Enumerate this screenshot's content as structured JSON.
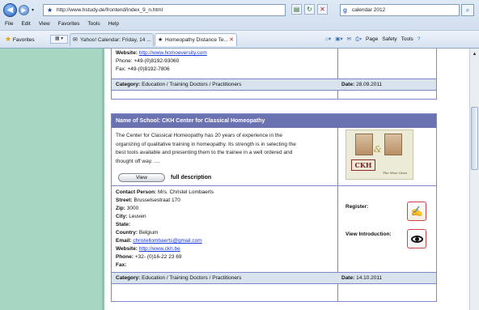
{
  "browser": {
    "address_url": "http://www.hstudy.de/frontend/index_9_n.html",
    "search_text": "calendar 2012",
    "menu": [
      "File",
      "Edit",
      "View",
      "Favorites",
      "Tools",
      "Help"
    ],
    "favorites_label": "Favorites",
    "tabs": [
      {
        "label": "Yahoo! Calendar: Friday, 14 ...",
        "active": false
      },
      {
        "label": "Homeopathy Distance Te...",
        "active": true
      }
    ],
    "commands": [
      "Page",
      "Safety",
      "Tools"
    ]
  },
  "prev_listing": {
    "website_label": "Website:",
    "website_url": "http://www.homoeversity.com",
    "phone": "Phone: +49-(0)8192-93060",
    "fax": "Fax: +49-(0)8192-7806",
    "category_label": "Category:",
    "category_value": "Education / Training Doctors / Practitioners",
    "date_label": "Date:",
    "date_value": "28.09.2011"
  },
  "listing": {
    "header": "Name of School: CKH Center for Classical Homeopathy",
    "description_lines": [
      "The Center for Classical Homeopathy has 20 years of experience in the",
      "organizing of qualitative training in homeopathy. Its strength is in selecting the",
      "best tools available and presenting them to the trainee in a well ordered and",
      "thought off way. ...."
    ],
    "view_button": "View",
    "full_description": "full description",
    "logo": {
      "letters": "CKH",
      "amp": "&",
      "caption": "The Wise Ones"
    },
    "contact_label": "Contact Person:",
    "contact_value": "Mrs. Christel Lombaerts",
    "street_label": "Street:",
    "street_value": "Brusselsestraat 170",
    "zip_label": "Zip:",
    "zip_value": "3000",
    "city_label": "City:",
    "city_value": "Leuven",
    "state_label": "State:",
    "state_value": "",
    "country_label": "Country:",
    "country_value": "Belgium",
    "email_label": "Email:",
    "email_value": "christellombaerts@gmail.com",
    "website_label": "Website:",
    "website_value": "http://www.ckh.be",
    "phone_label": "Phone:",
    "phone_value": "+32- (0)16-22 23 69",
    "fax_label": "Fax:",
    "fax_value": "",
    "register_label": "Register:",
    "intro_label": "View Introduction:",
    "category_label": "Category:",
    "category_value": "Education / Training Doctors / Practitioners",
    "date_label": "Date:",
    "date_value": "14.10.2011"
  },
  "colors": {
    "left_panel": "#a7d6c2",
    "header_bar": "#6b72b2",
    "footer_bar": "#d8e3ee",
    "link": "#1a35d8"
  }
}
